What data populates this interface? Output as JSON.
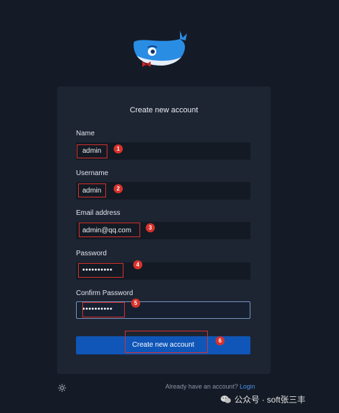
{
  "logo": {
    "icon": "docker-whale-icon"
  },
  "form": {
    "title": "Create new account",
    "fields": {
      "name": {
        "label": "Name",
        "value": "admin"
      },
      "username": {
        "label": "Username",
        "value": "admin"
      },
      "email": {
        "label": "Email address",
        "value": "admin@qq.com"
      },
      "password": {
        "label": "Password",
        "value": "••••••••••"
      },
      "confirm_password": {
        "label": "Confirm Password",
        "value": "••••••••••"
      }
    },
    "submit_label": "Create new account"
  },
  "annotations": [
    "1",
    "2",
    "3",
    "4",
    "5",
    "6"
  ],
  "annotation_color": "#d8322c",
  "footer": {
    "question": "Already have an account?",
    "login_link": "Login",
    "theme_toggle_icon": "sun-icon"
  },
  "watermark": {
    "text": "公众号 · soft张三丰",
    "icon": "wechat-icon"
  }
}
